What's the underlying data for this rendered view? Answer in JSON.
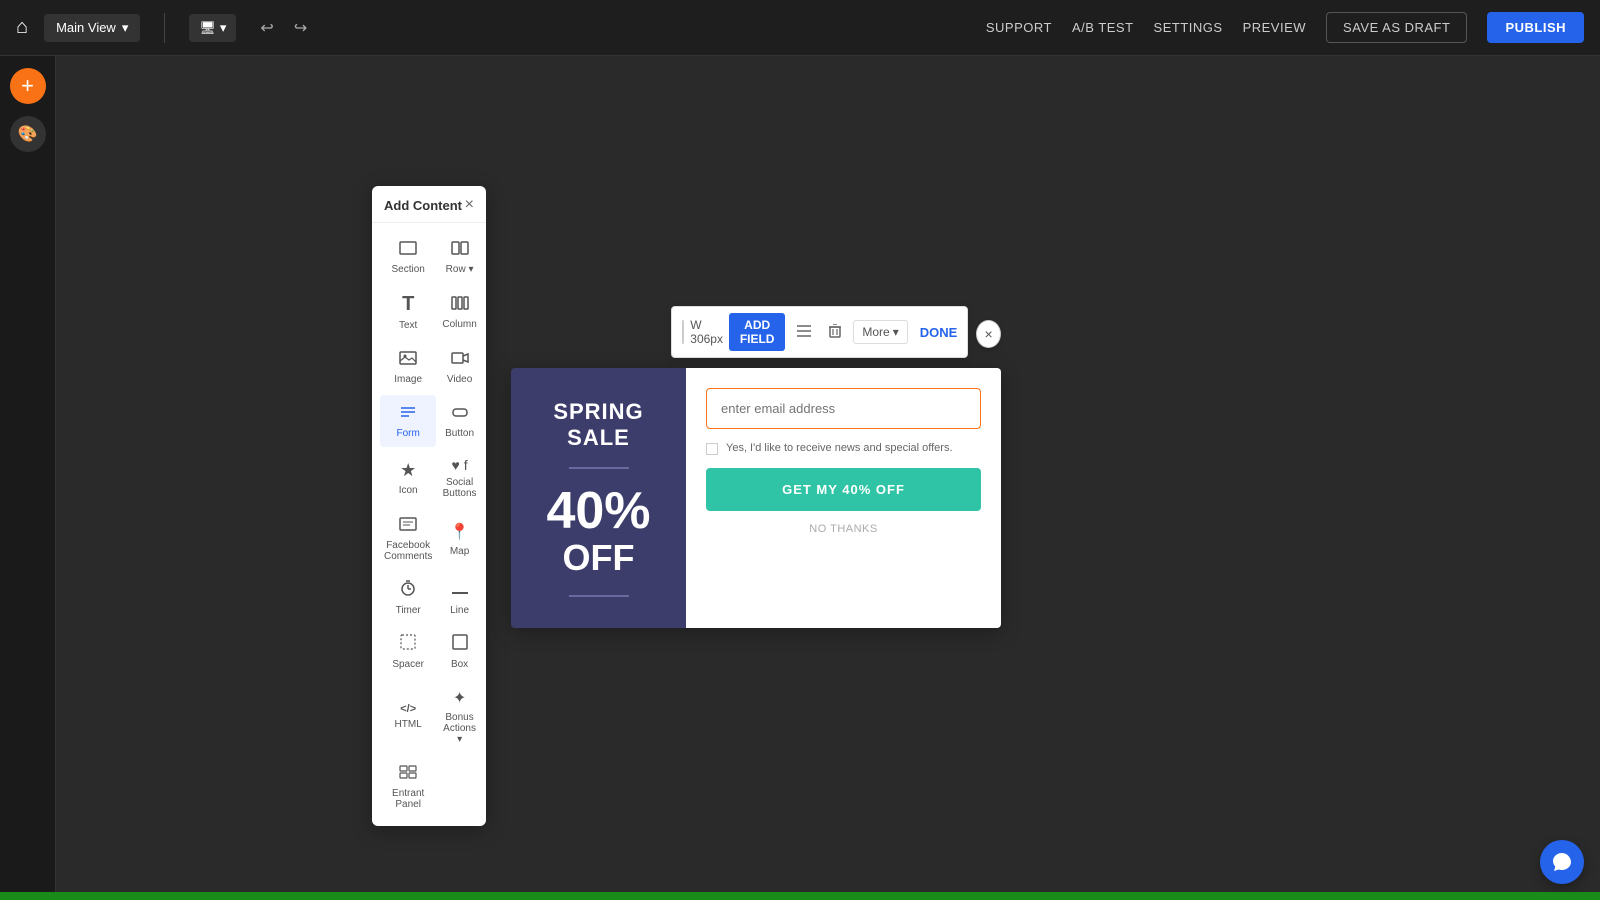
{
  "navbar": {
    "view_selector": "Main View",
    "view_arrow": "▾",
    "device_icon": "🖥",
    "device_arrow": "▾",
    "undo_icon": "↩",
    "redo_icon": "↪",
    "support": "SUPPORT",
    "ab_test": "A/B TEST",
    "settings": "SETTINGS",
    "preview": "PREVIEW",
    "save_draft": "SAVE AS DRAFT",
    "publish": "PUBLISH"
  },
  "left_sidebar": {
    "add_btn": "+",
    "theme_icon": "🎨"
  },
  "add_content_panel": {
    "title": "Add Content",
    "close_icon": "×",
    "items": [
      {
        "id": "section",
        "icon": "⬜",
        "label": "Section"
      },
      {
        "id": "row",
        "icon": "⬛",
        "label": "Row ▾"
      },
      {
        "id": "text",
        "icon": "T",
        "label": "Text"
      },
      {
        "id": "column",
        "icon": "▦",
        "label": "Column"
      },
      {
        "id": "image",
        "icon": "🖼",
        "label": "Image"
      },
      {
        "id": "video",
        "icon": "▶",
        "label": "Video"
      },
      {
        "id": "form",
        "icon": "≡",
        "label": "Form"
      },
      {
        "id": "button",
        "icon": "⬭",
        "label": "Button"
      },
      {
        "id": "icon",
        "icon": "★",
        "label": "Icon"
      },
      {
        "id": "social",
        "icon": "♥",
        "label": "Social Buttons"
      },
      {
        "id": "facebook",
        "icon": "f",
        "label": "Facebook Comments"
      },
      {
        "id": "map",
        "icon": "📍",
        "label": "Map"
      },
      {
        "id": "timer",
        "icon": "⏱",
        "label": "Timer"
      },
      {
        "id": "line",
        "icon": "—",
        "label": "Line"
      },
      {
        "id": "spacer",
        "icon": "↕",
        "label": "Spacer"
      },
      {
        "id": "box",
        "icon": "□",
        "label": "Box"
      },
      {
        "id": "html",
        "icon": "</>",
        "label": "HTML"
      },
      {
        "id": "bonus",
        "icon": "✦",
        "label": "Bonus Actions ▾"
      },
      {
        "id": "entrant",
        "icon": "⊞",
        "label": "Entrant Panel"
      }
    ]
  },
  "popup_toolbar": {
    "width_label": "W 306px",
    "add_field_label": "ADD FIELD",
    "list_icon": "≡",
    "delete_icon": "🗑",
    "more_label": "More",
    "more_arrow": "▾",
    "done_label": "DONE",
    "close_icon": "×"
  },
  "popup": {
    "left": {
      "title": "SPRING SALE",
      "percent": "40%",
      "off": "OFF"
    },
    "right": {
      "email_placeholder": "enter email address",
      "checkbox_text": "Yes, I'd like to receive news and special offers.",
      "cta_button": "GET MY 40% OFF",
      "no_thanks": "NO THANKS"
    }
  },
  "colors": {
    "accent_blue": "#2563eb",
    "teal": "#2ec4a5",
    "orange": "#f97316",
    "purple_bg": "#3d3d6b"
  }
}
